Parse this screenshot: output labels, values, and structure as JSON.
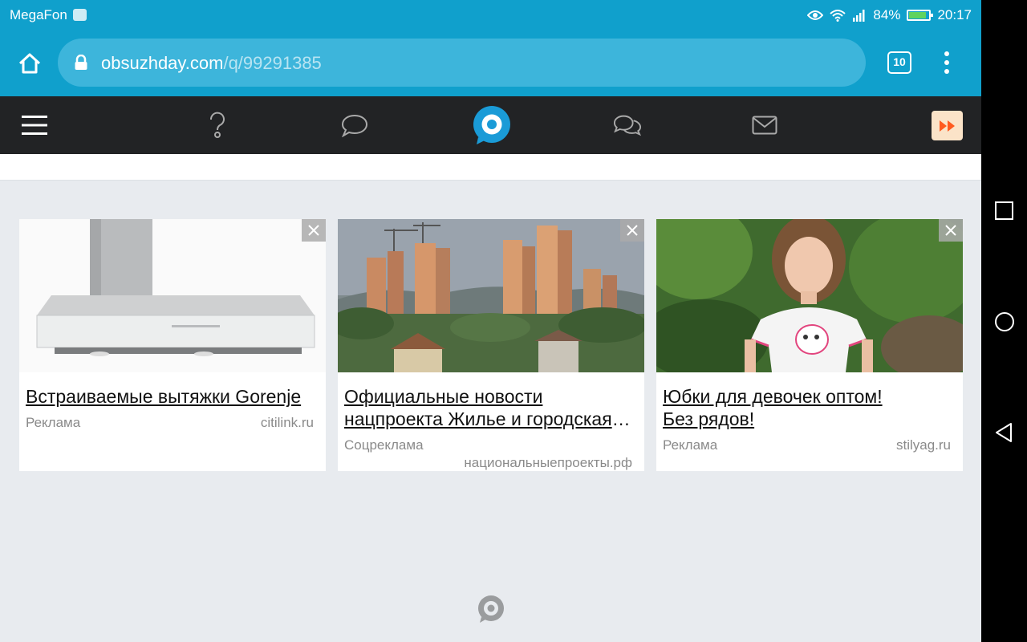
{
  "statusbar": {
    "carrier": "MegaFon",
    "battery": "84%",
    "time": "20:17"
  },
  "browser": {
    "url_domain": "obsuzhday.com",
    "url_path": "/q/99291385",
    "tab_count": "10"
  },
  "sitenav": {
    "items": [
      "menu-icon",
      "question-icon",
      "comment-icon",
      "site-logo",
      "chat-icon",
      "mail-icon",
      "fast-forward-icon"
    ]
  },
  "ads": [
    {
      "title": "Встраиваемые вытяжки Gorenje",
      "label": "Реклама",
      "domain": "citilink.ru"
    },
    {
      "title": "Официальные новости нацпроекта Жилье и городская среда",
      "label": "Соцреклама",
      "domain": "национальныепроекты.рф"
    },
    {
      "title": "Юбки для девочек оптом! Без рядов!",
      "label": "Реклама",
      "domain": "stilyag.ru"
    }
  ],
  "colors": {
    "chrome": "#10a0cc",
    "sitenav": "#222325",
    "accent": "#1a9bd7",
    "page_bg": "#e8ebef"
  }
}
